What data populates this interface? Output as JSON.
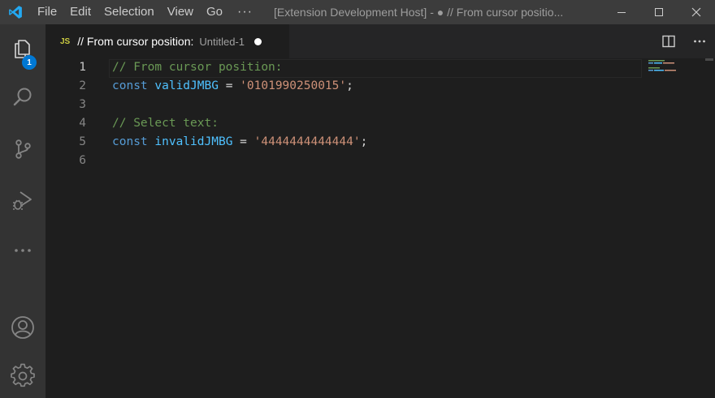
{
  "titlebar": {
    "menu": [
      "File",
      "Edit",
      "Selection",
      "View",
      "Go"
    ],
    "more": "···",
    "window_title": "[Extension Development Host] - ● // From cursor positio..."
  },
  "activity": {
    "explorer_badge": "1"
  },
  "tab": {
    "lang": "JS",
    "title": "// From cursor position:",
    "description": "Untitled-1"
  },
  "editor": {
    "lines": [
      {
        "number": "1",
        "tokens": [
          {
            "t": "// From cursor position:",
            "k": "comment"
          }
        ]
      },
      {
        "number": "2",
        "tokens": [
          {
            "t": "const",
            "k": "kw"
          },
          {
            "t": " ",
            "k": "op"
          },
          {
            "t": "validJMBG",
            "k": "var"
          },
          {
            "t": " = ",
            "k": "op"
          },
          {
            "t": "'0101990250015'",
            "k": "str"
          },
          {
            "t": ";",
            "k": "punct"
          }
        ]
      },
      {
        "number": "3",
        "tokens": []
      },
      {
        "number": "4",
        "tokens": [
          {
            "t": "// Select text:",
            "k": "comment"
          }
        ]
      },
      {
        "number": "5",
        "tokens": [
          {
            "t": "const",
            "k": "kw"
          },
          {
            "t": " ",
            "k": "op"
          },
          {
            "t": "invalidJMBG",
            "k": "var"
          },
          {
            "t": " = ",
            "k": "op"
          },
          {
            "t": "'4444444444444'",
            "k": "str"
          },
          {
            "t": ";",
            "k": "punct"
          }
        ]
      },
      {
        "number": "6",
        "tokens": []
      }
    ]
  },
  "colors": {
    "comment": "#6a9955",
    "keyword": "#569cd6",
    "variable": "#4fc1ff",
    "string": "#ce9178",
    "badge": "#0078d4"
  }
}
